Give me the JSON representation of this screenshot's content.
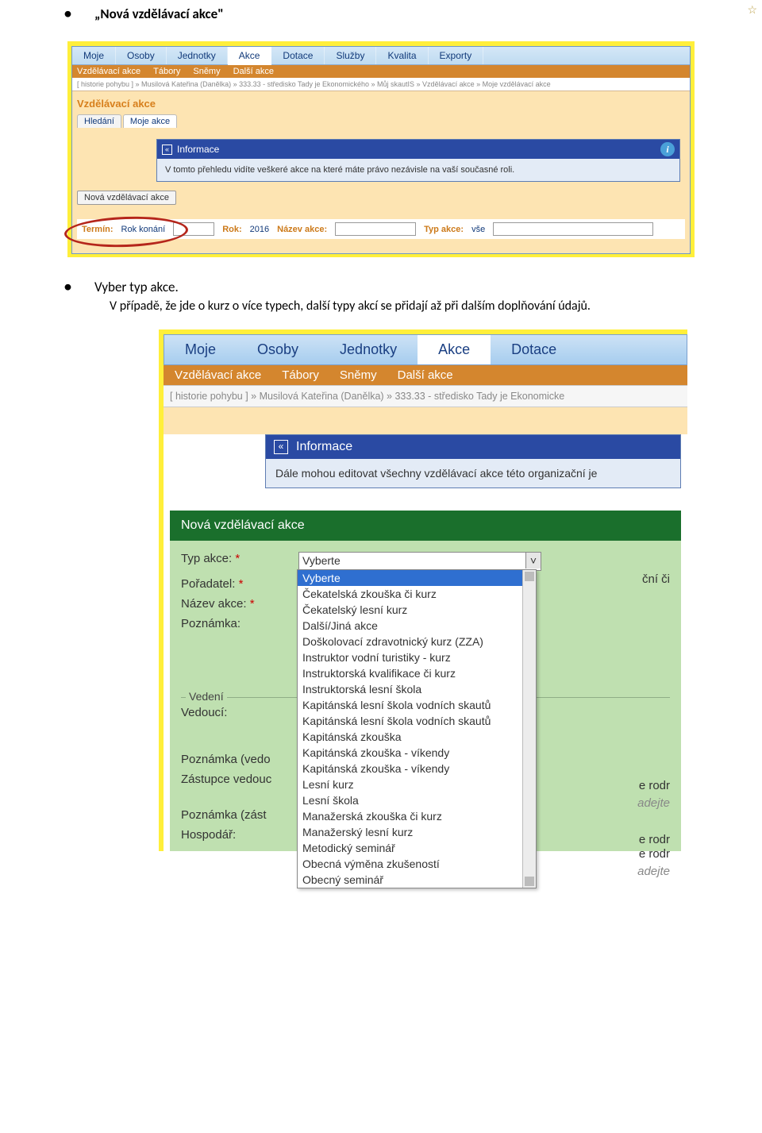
{
  "bullets": {
    "item1": "„Nová vzdělávací akce\"",
    "item2_a": "Vyber typ akce. ",
    "item2_b": "V případě, že jde o kurz o více typech, další typy akcí se přidají až při dalším doplňování údajů."
  },
  "screenshot1": {
    "menu": [
      "Moje",
      "Osoby",
      "Jednotky",
      "Akce",
      "Dotace",
      "Služby",
      "Kvalita",
      "Exporty"
    ],
    "submenu": [
      "Vzdělávací akce",
      "Tábory",
      "Sněmy",
      "Další akce"
    ],
    "breadcrumb": "[ historie pohybu ] » Musilová Kateřina (Danělka) » 333.33 - středisko Tady je Ekonomického » Můj skautIS » Vzdělávací akce » Moje vzdělávací akce",
    "section_title": "Vzdělávací akce",
    "tabs": [
      "Hledání",
      "Moje akce"
    ],
    "info_title": "Informace",
    "info_body": "V tomto přehledu vidíte veškeré akce na které máte právo nezávisle na vaší současné roli.",
    "new_button": "Nová vzdělávací akce",
    "filters": {
      "termin": "Termín:",
      "termin_v": "Rok konání",
      "rok": "Rok:",
      "rok_v": "2016",
      "nazev": "Název akce:",
      "typ": "Typ akce:",
      "typ_v": "vše"
    }
  },
  "screenshot2": {
    "menu": [
      "Moje",
      "Osoby",
      "Jednotky",
      "Akce",
      "Dotace"
    ],
    "submenu": [
      "Vzdělávací akce",
      "Tábory",
      "Sněmy",
      "Další akce"
    ],
    "breadcrumb": "[ historie pohybu ] » Musilová Kateřina (Danělka) » 333.33 - středisko Tady je Ekonomicke",
    "info_title": "Informace",
    "info_body": "Dále mohou editovat všechny vzdělávací akce této organizační je",
    "green_title": "Nová vzdělávací akce",
    "form_labels": {
      "typ": "Typ akce:",
      "poradatel": "Pořadatel:",
      "nazev": "Název akce:",
      "poznamka": "Poznámka:",
      "vedeni": "Vedení",
      "vedouci": "Vedoucí:",
      "poznamka_vedo": "Poznámka (vedo",
      "zastupce": "Zástupce vedouc",
      "poznamka_zast": "Poznámka (zást",
      "hospodar": "Hospodář:"
    },
    "select_placeholder": "Vyberte",
    "options": [
      "Vyberte",
      "Čekatelská zkouška či kurz",
      "Čekatelský lesní kurz",
      "Další/Jiná akce",
      "Doškolovací zdravotnický kurz (ZZA)",
      "Instruktor vodní turistiky - kurz",
      "Instruktorská kvalifikace či kurz",
      "Instruktorská lesní škola",
      "Kapitánská lesní škola vodních skautů",
      "Kapitánská lesní škola vodních skautů",
      "Kapitánská zkouška",
      "Kapitánská zkouška - víkendy",
      "Kapitánská zkouška - víkendy",
      "Lesní kurz",
      "Lesní škola",
      "Manažerská zkouška či kurz",
      "Manažerský lesní kurz",
      "Metodický seminář",
      "Obecná výměna zkušeností",
      "Obecný seminář"
    ],
    "right_fragments": {
      "cni": "ční či",
      "rodr1": "e rodr",
      "adejte1": "adejte",
      "rodr2": "e rodr",
      "adejte2": "adejte",
      "rodr3": "e rodr"
    }
  }
}
